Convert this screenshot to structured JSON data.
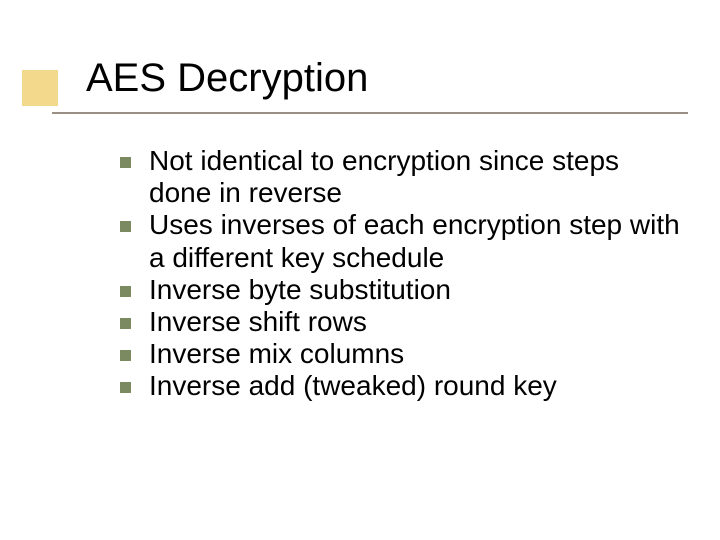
{
  "title": "AES Decryption",
  "bullets": [
    {
      "text": "Not identical to encryption since steps done in reverse"
    },
    {
      "text": "Uses inverses of each encryption step with a different key schedule"
    },
    {
      "text": "Inverse byte substitution"
    },
    {
      "text": "Inverse shift rows"
    },
    {
      "text": "Inverse mix columns"
    },
    {
      "text": "Inverse add (tweaked) round key"
    }
  ],
  "colors": {
    "accent_block": "#f2d98c",
    "bullet": "#7c8a62",
    "underline": "#9a8f85"
  }
}
